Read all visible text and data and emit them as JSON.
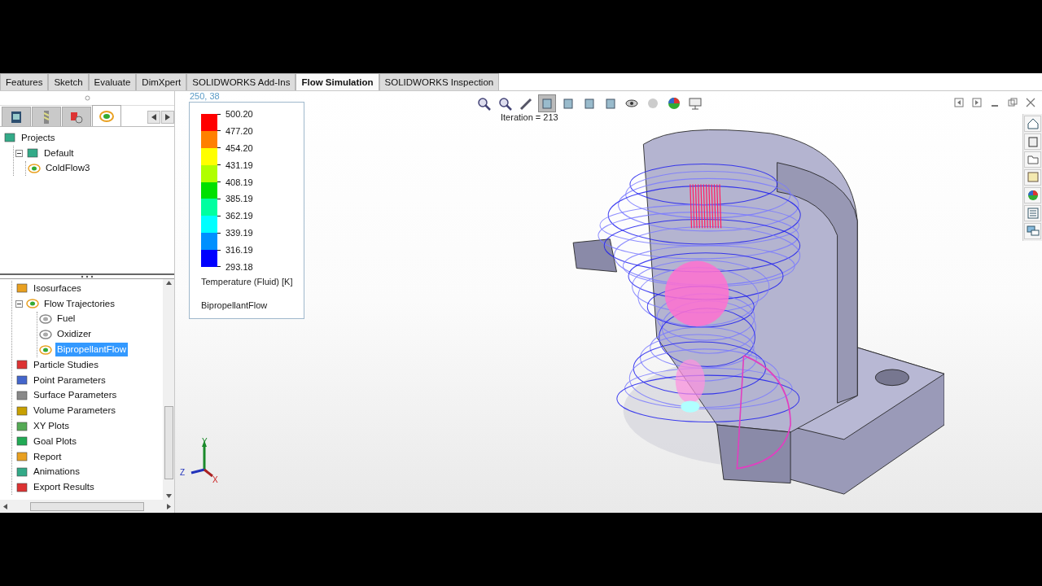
{
  "command_tabs": [
    {
      "label": "Features",
      "selected": false
    },
    {
      "label": "Sketch",
      "selected": false
    },
    {
      "label": "Evaluate",
      "selected": false
    },
    {
      "label": "DimXpert",
      "selected": false
    },
    {
      "label": "SOLIDWORKS Add-Ins",
      "selected": false
    },
    {
      "label": "Flow Simulation",
      "selected": true
    },
    {
      "label": "SOLIDWORKS Inspection",
      "selected": false
    }
  ],
  "panel_tabs": [
    {
      "selected": false
    },
    {
      "selected": false
    },
    {
      "selected": false
    },
    {
      "selected": true
    }
  ],
  "project_tree": [
    {
      "label": "Projects",
      "children": [
        {
          "label": "Default",
          "expanded": true,
          "children": [
            {
              "label": "ColdFlow3"
            }
          ]
        }
      ]
    }
  ],
  "results_tree": [
    {
      "label": "Isosurfaces",
      "selected": false
    },
    {
      "label": "Flow Trajectories",
      "selected": false,
      "expanded": true,
      "children": [
        {
          "label": "Fuel",
          "selected": false
        },
        {
          "label": "Oxidizer",
          "selected": false
        },
        {
          "label": "BipropellantFlow",
          "selected": true
        }
      ]
    },
    {
      "label": "Particle Studies",
      "selected": false
    },
    {
      "label": "Point Parameters",
      "selected": false
    },
    {
      "label": "Surface Parameters",
      "selected": false
    },
    {
      "label": "Volume Parameters",
      "selected": false
    },
    {
      "label": "XY Plots",
      "selected": false
    },
    {
      "label": "Goal Plots",
      "selected": false
    },
    {
      "label": "Report",
      "selected": false
    },
    {
      "label": "Animations",
      "selected": false
    },
    {
      "label": "Export Results",
      "selected": false
    }
  ],
  "viewport": {
    "cursor_coords": "250, 38",
    "iteration": "Iteration = 213",
    "legend": {
      "ticks": [
        "500.20",
        "477.20",
        "454.20",
        "431.19",
        "408.19",
        "385.19",
        "362.19",
        "339.19",
        "316.19",
        "293.18"
      ],
      "bands": [
        {
          "color": "#ff0000"
        },
        {
          "color": "#ff8000"
        },
        {
          "color": "#ffff00"
        },
        {
          "color": "#b0ff00"
        },
        {
          "color": "#00e000"
        },
        {
          "color": "#00ffa0"
        },
        {
          "color": "#00ffff"
        },
        {
          "color": "#0090ff"
        },
        {
          "color": "#0000ff"
        }
      ],
      "parameter": "Temperature (Fluid) [K]",
      "name": "BipropellantFlow"
    },
    "triad": {
      "x": "X",
      "y": "Y",
      "z": "Z"
    }
  }
}
